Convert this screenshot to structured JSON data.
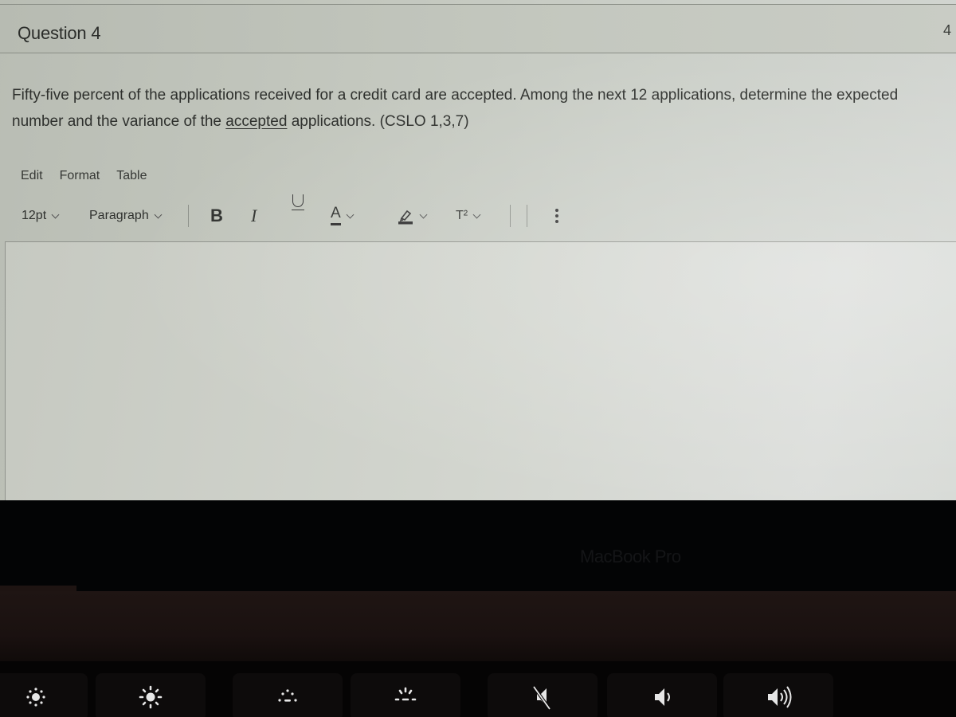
{
  "question": {
    "title": "Question 4",
    "points": "4",
    "text_before_underline": "Fifty-five percent of the applications received for a credit card are accepted. Among the next 12 applications, determine the expected number and the variance of the ",
    "underlined_word": "accepted",
    "text_after_underline": " applications. (CSLO 1,3,7)"
  },
  "editor": {
    "menubar": [
      "Edit",
      "Format",
      "Table"
    ],
    "toolbar": {
      "font_size": "12pt",
      "block_format": "Paragraph",
      "bold": "B",
      "italic": "I",
      "text_color": "A",
      "superscript": "T²"
    },
    "content": ""
  },
  "device": {
    "bezel_label": "MacBook Pro",
    "keys": [
      "brightness-down-icon",
      "brightness-up-icon",
      "keyboard-backlight-down-icon",
      "keyboard-backlight-up-icon",
      "mute-icon",
      "volume-down-icon",
      "volume-up-icon"
    ]
  }
}
